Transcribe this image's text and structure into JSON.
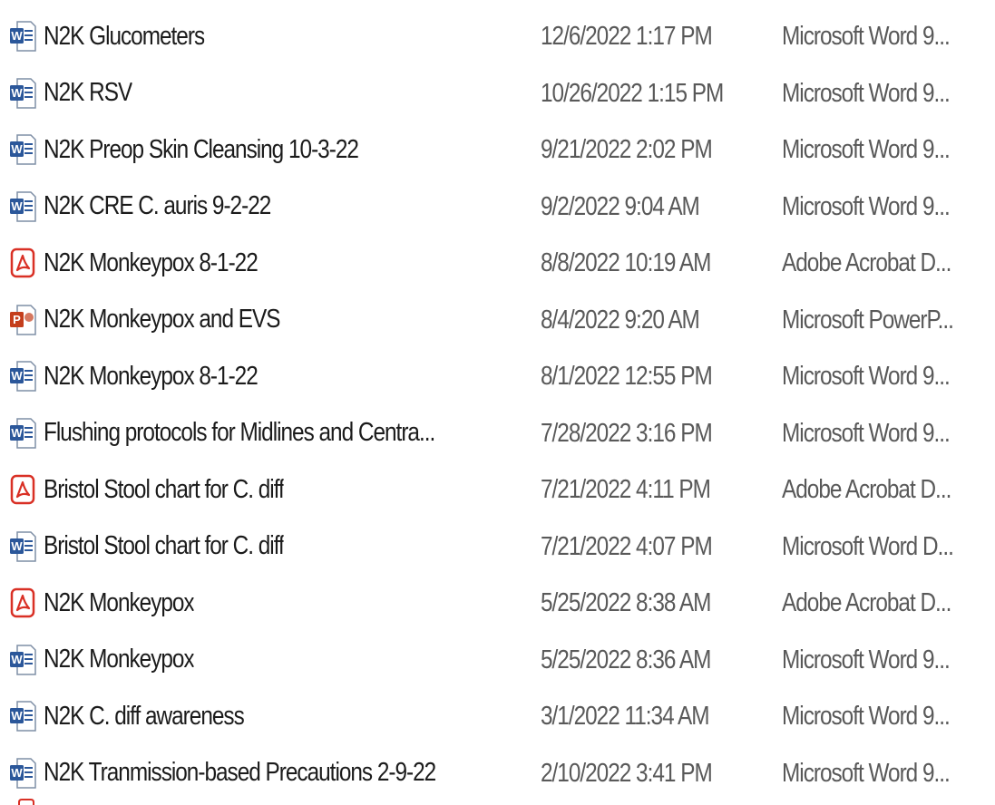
{
  "files": [
    {
      "name": "N2K Glucometers",
      "date": "12/6/2022 1:17 PM",
      "type": "Microsoft Word 9...",
      "icon": "word-doc-icon"
    },
    {
      "name": "N2K RSV",
      "date": "10/26/2022 1:15 PM",
      "type": "Microsoft Word 9...",
      "icon": "word-doc-icon"
    },
    {
      "name": "N2K Preop Skin Cleansing 10-3-22",
      "date": "9/21/2022 2:02 PM",
      "type": "Microsoft Word 9...",
      "icon": "word-doc-icon"
    },
    {
      "name": "N2K CRE C. auris 9-2-22",
      "date": "9/2/2022 9:04 AM",
      "type": "Microsoft Word 9...",
      "icon": "word-doc-icon"
    },
    {
      "name": "N2K Monkeypox 8-1-22",
      "date": "8/8/2022 10:19 AM",
      "type": "Adobe Acrobat D...",
      "icon": "pdf-icon"
    },
    {
      "name": "N2K Monkeypox and EVS",
      "date": "8/4/2022 9:20 AM",
      "type": "Microsoft PowerP...",
      "icon": "powerpoint-icon"
    },
    {
      "name": "N2K Monkeypox 8-1-22",
      "date": "8/1/2022 12:55 PM",
      "type": "Microsoft Word 9...",
      "icon": "word-doc-icon"
    },
    {
      "name": "Flushing protocols for Midlines and Centra...",
      "date": "7/28/2022 3:16 PM",
      "type": "Microsoft Word 9...",
      "icon": "word-doc-icon"
    },
    {
      "name": "Bristol Stool chart for C. diff",
      "date": "7/21/2022 4:11 PM",
      "type": "Adobe Acrobat D...",
      "icon": "pdf-icon"
    },
    {
      "name": "Bristol Stool chart for C. diff",
      "date": "7/21/2022 4:07 PM",
      "type": "Microsoft Word D...",
      "icon": "word-doc-icon"
    },
    {
      "name": "N2K Monkeypox",
      "date": "5/25/2022 8:38 AM",
      "type": "Adobe Acrobat D...",
      "icon": "pdf-icon"
    },
    {
      "name": "N2K Monkeypox",
      "date": "5/25/2022 8:36 AM",
      "type": "Microsoft Word 9...",
      "icon": "word-doc-icon"
    },
    {
      "name": "N2K C. diff awareness",
      "date": "3/1/2022 11:34 AM",
      "type": "Microsoft Word 9...",
      "icon": "word-doc-icon"
    },
    {
      "name": "N2K Tranmission-based Precautions 2-9-22",
      "date": "2/10/2022 3:41 PM",
      "type": "Microsoft Word 9...",
      "icon": "word-doc-icon"
    }
  ],
  "colors": {
    "word_blue": "#2b579a",
    "pdf_red": "#d93025",
    "powerpoint_orange": "#c43e1c"
  }
}
